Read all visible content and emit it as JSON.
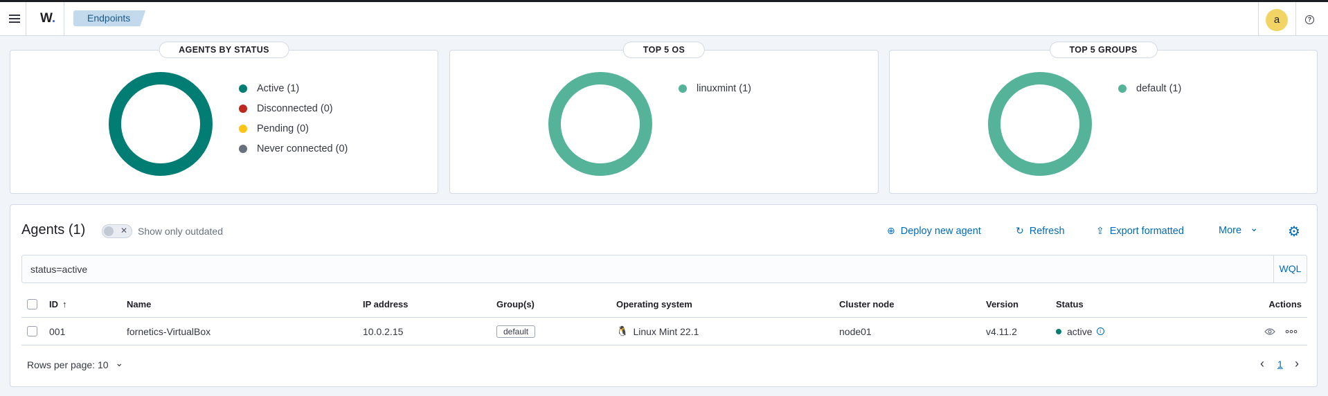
{
  "header": {
    "logo": "W",
    "breadcrumb": "Endpoints",
    "avatar_initial": "a",
    "help_glyph": "?"
  },
  "panels": [
    {
      "title": "AGENTS BY STATUS",
      "legend": [
        {
          "label": "Active (1)",
          "color": "#017d73"
        },
        {
          "label": "Disconnected (0)",
          "color": "#bd271e"
        },
        {
          "label": "Pending (0)",
          "color": "#fec514"
        },
        {
          "label": "Never connected (0)",
          "color": "#69707d"
        }
      ],
      "ring_color": "#017d73"
    },
    {
      "title": "TOP 5 OS",
      "legend": [
        {
          "label": "linuxmint (1)",
          "color": "#54b399"
        }
      ],
      "ring_color": "#54b399"
    },
    {
      "title": "TOP 5 GROUPS",
      "legend": [
        {
          "label": "default (1)",
          "color": "#54b399"
        }
      ],
      "ring_color": "#54b399"
    }
  ],
  "agents": {
    "title": "Agents (1)",
    "outdated_toggle_label": "Show only outdated",
    "actions": {
      "deploy": "Deploy new agent",
      "refresh": "Refresh",
      "export": "Export formatted",
      "more": "More"
    },
    "search": {
      "value": "status=active",
      "wql_label": "WQL"
    },
    "columns": [
      "ID",
      "Name",
      "IP address",
      "Group(s)",
      "Operating system",
      "Cluster node",
      "Version",
      "Status",
      "Actions"
    ],
    "rows": [
      {
        "id": "001",
        "name": "fornetics-VirtualBox",
        "ip": "10.0.2.15",
        "group": "default",
        "os": "Linux Mint 22.1",
        "cluster_node": "node01",
        "version": "v4.11.2",
        "status": "active"
      }
    ],
    "rows_per_page_label": "Rows per page: 10",
    "current_page": "1"
  },
  "icons": {
    "sort_asc": "↑",
    "chevron_down": "⌄",
    "prev": "‹",
    "next": "›"
  }
}
